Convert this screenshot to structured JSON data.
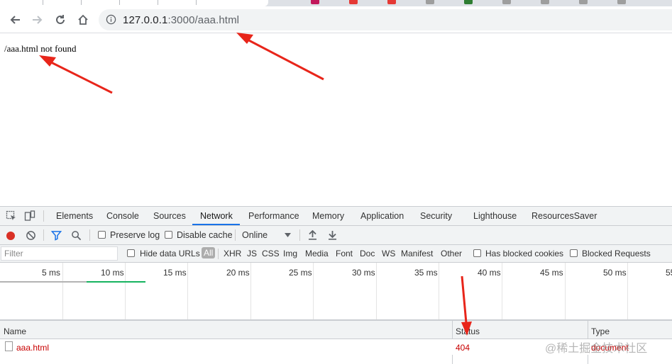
{
  "browser": {
    "url_host": "127.0.0.1",
    "url_path": ":3000/aaa.html"
  },
  "page": {
    "message": "/aaa.html not found"
  },
  "devtools": {
    "tabs": [
      "Elements",
      "Console",
      "Sources",
      "Network",
      "Performance",
      "Memory",
      "Application",
      "Security",
      "Lighthouse",
      "ResourcesSaver"
    ],
    "active_tab": "Network",
    "controls": {
      "preserve_log": "Preserve log",
      "disable_cache": "Disable cache",
      "throttling": "Online"
    },
    "filter": {
      "placeholder": "Filter",
      "hide_data_urls": "Hide data URLs",
      "types": [
        "All",
        "XHR",
        "JS",
        "CSS",
        "Img",
        "Media",
        "Font",
        "Doc",
        "WS",
        "Manifest",
        "Other"
      ],
      "has_blocked_cookies": "Has blocked cookies",
      "blocked_requests": "Blocked Requests"
    },
    "timeline_ticks": [
      "5 ms",
      "10 ms",
      "15 ms",
      "20 ms",
      "25 ms",
      "30 ms",
      "35 ms",
      "40 ms",
      "45 ms",
      "50 ms",
      "55"
    ],
    "columns": {
      "name": "Name",
      "status": "Status",
      "type": "Type"
    },
    "requests": [
      {
        "name": "aaa.html",
        "status": "404",
        "type": "document"
      }
    ]
  },
  "watermark": "@稀土掘金技术社区",
  "colors": {
    "accent": "#1a73e8",
    "error": "#c80000",
    "record": "#d93025",
    "annotation": "#e8251a"
  }
}
